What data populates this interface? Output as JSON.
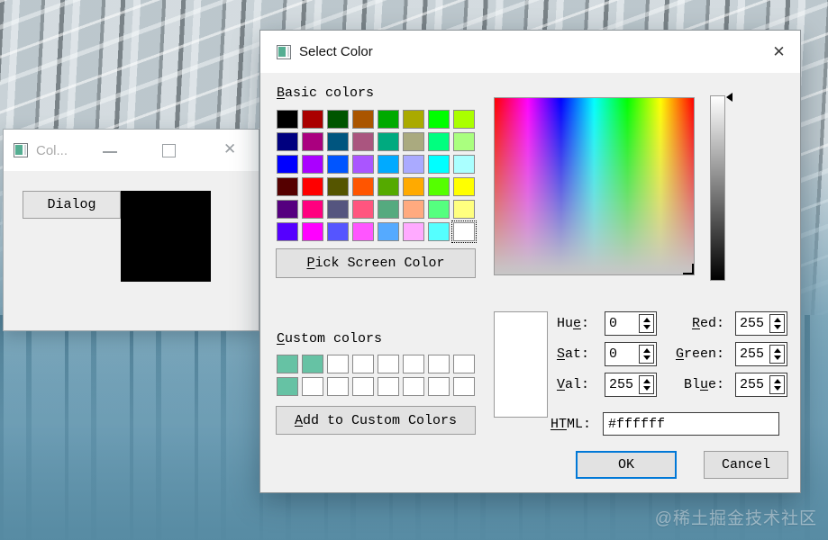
{
  "desktop": {
    "watermark": "@稀土掘金技术社区"
  },
  "child_window": {
    "title": "Col...",
    "dialog_button_label": "Dialog",
    "swatch_color": "#000000"
  },
  "dialog": {
    "title": "Select Color",
    "labels": {
      "basic": {
        "pre": "",
        "u": "B",
        "post": "asic colors"
      },
      "pick": {
        "pre": "",
        "u": "P",
        "post": "ick Screen Color"
      },
      "custom": {
        "pre": "",
        "u": "C",
        "post": "ustom colors"
      },
      "add": {
        "pre": "",
        "u": "A",
        "post": "dd to Custom Colors"
      },
      "hue": {
        "pre": "Hu",
        "u": "e",
        "post": ":"
      },
      "sat": {
        "pre": "",
        "u": "S",
        "post": "at:"
      },
      "val": {
        "pre": "",
        "u": "V",
        "post": "al:"
      },
      "red": {
        "pre": "",
        "u": "R",
        "post": "ed:"
      },
      "green": {
        "pre": "",
        "u": "G",
        "post": "reen:"
      },
      "blue": {
        "pre": "Bl",
        "u": "u",
        "post": "e:"
      },
      "html": {
        "pre": "",
        "u": "HT",
        "post": "ML:"
      }
    },
    "values": {
      "hue": "0",
      "sat": "0",
      "val": "255",
      "red": "255",
      "green": "255",
      "blue": "255",
      "html": "#ffffff"
    },
    "basic_colors": [
      "#000000",
      "#aa0000",
      "#005500",
      "#aa5500",
      "#00aa00",
      "#aaaa00",
      "#00ff00",
      "#aaff00",
      "#00007f",
      "#aa007f",
      "#00557f",
      "#aa557f",
      "#00aa7f",
      "#aaaa7f",
      "#00ff7f",
      "#aaff7f",
      "#0000ff",
      "#aa00ff",
      "#0055ff",
      "#aa55ff",
      "#00aaff",
      "#aaaaff",
      "#00ffff",
      "#aaffff",
      "#550000",
      "#ff0000",
      "#555500",
      "#ff5500",
      "#55aa00",
      "#ffaa00",
      "#55ff00",
      "#ffff00",
      "#55007f",
      "#ff007f",
      "#55557f",
      "#ff557f",
      "#55aa7f",
      "#ffaa7f",
      "#55ff7f",
      "#ffff7f",
      "#5500ff",
      "#ff00ff",
      "#5555ff",
      "#ff55ff",
      "#55aaff",
      "#ffaaff",
      "#55ffff",
      "#ffffff"
    ],
    "selected_basic_index": 47,
    "custom_colors": [
      "#66c2a4",
      "#66c2a4",
      "#ffffff",
      "#ffffff",
      "#ffffff",
      "#ffffff",
      "#ffffff",
      "#ffffff",
      "#66c2a4",
      "#ffffff",
      "#ffffff",
      "#ffffff",
      "#ffffff",
      "#ffffff",
      "#ffffff",
      "#ffffff"
    ],
    "ok_label": "OK",
    "cancel_label": "Cancel",
    "colors": {
      "accent_focus": "#0078d7",
      "titlebar_bg": "#ffffff",
      "dialog_bg": "#f0f0f0",
      "custom_teal": "#66c2a4"
    }
  }
}
